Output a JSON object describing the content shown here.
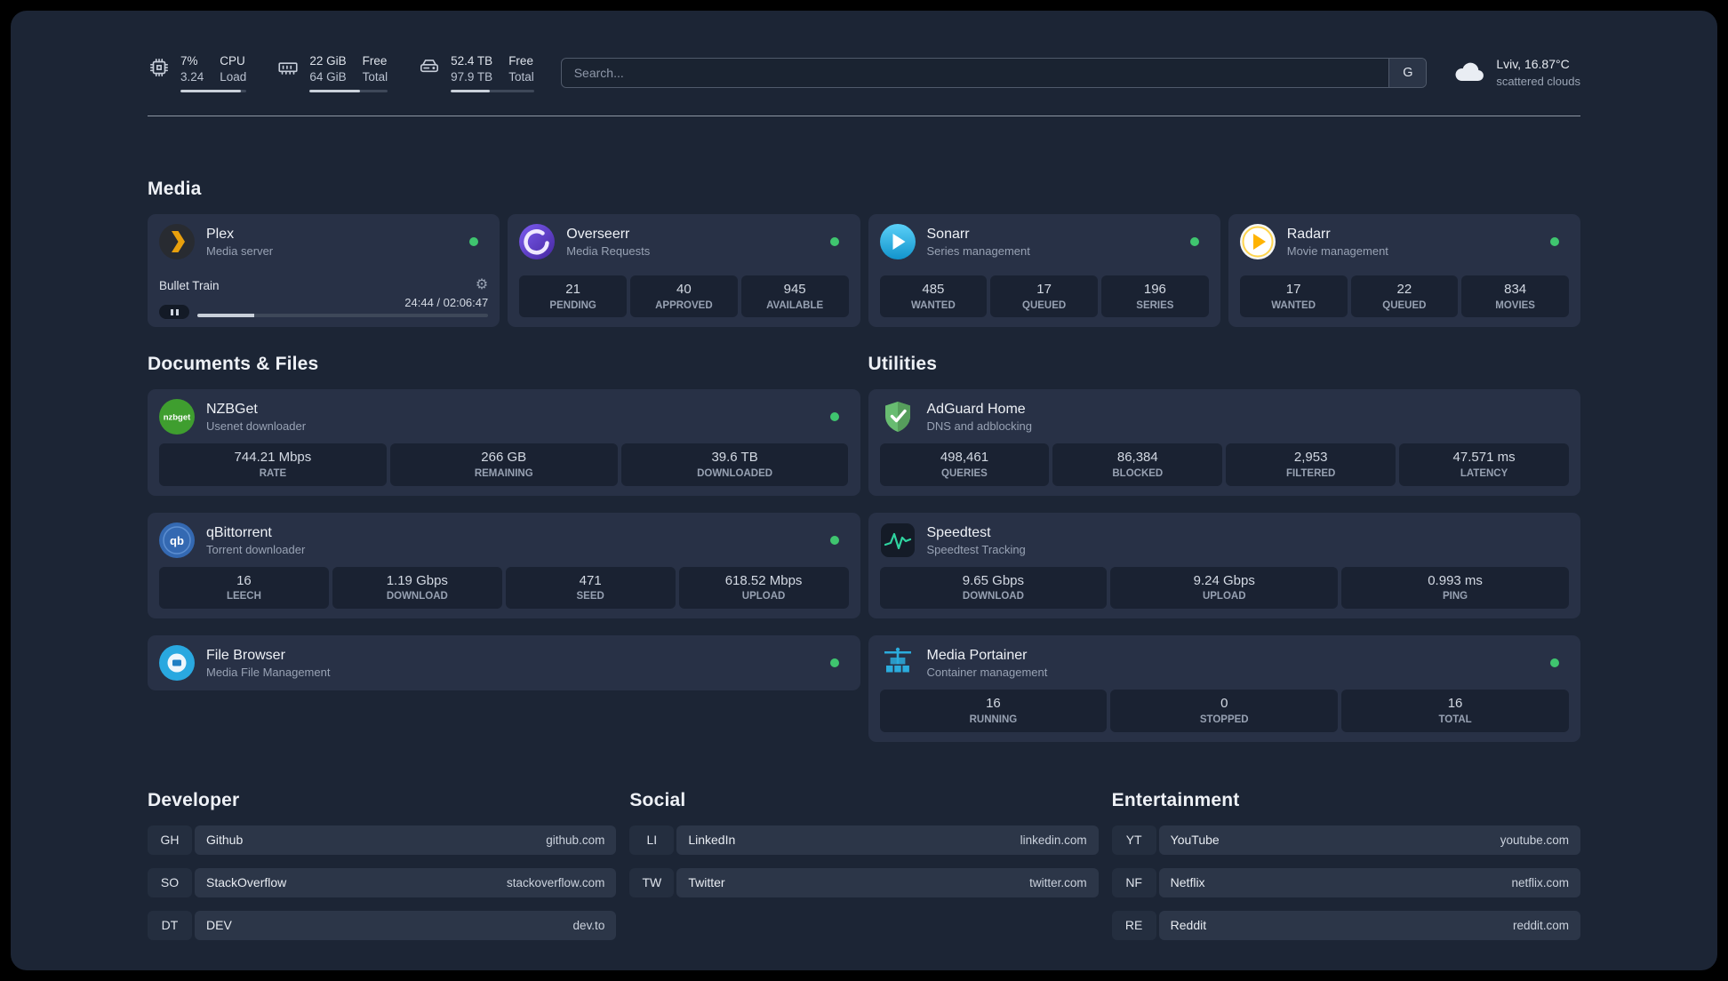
{
  "colors": {
    "background": "#1c2535",
    "status_green": "#3fc56f",
    "plex_gold": "#e8a00d",
    "portainer_blue": "#2bacdd",
    "adguard_green": "#63b663"
  },
  "topbar": {
    "resources": [
      {
        "value_top": "7%",
        "value_bottom": "3.24",
        "label_top": "CPU",
        "label_bottom": "Load",
        "progress_pct": 92
      },
      {
        "value_top": "22 GiB",
        "value_bottom": "64 GiB",
        "label_top": "Free",
        "label_bottom": "Total",
        "progress_pct": 65
      },
      {
        "value_top": "52.4 TB",
        "value_bottom": "97.9 TB",
        "label_top": "Free",
        "label_bottom": "Total",
        "progress_pct": 47
      }
    ],
    "search": {
      "placeholder": "Search...",
      "provider_label": "G"
    },
    "weather": {
      "location": "Lviv, 16.87°C",
      "condition": "scattered clouds"
    }
  },
  "media": {
    "heading": "Media",
    "plex": {
      "name": "Plex",
      "description": "Media server",
      "now_playing": {
        "title": "Bullet Train",
        "time": "24:44 / 02:06:47",
        "progress_pct": 19.6
      }
    },
    "overseerr": {
      "name": "Overseerr",
      "description": "Media Requests",
      "stats": [
        {
          "value": "21",
          "label": "PENDING"
        },
        {
          "value": "40",
          "label": "APPROVED"
        },
        {
          "value": "945",
          "label": "AVAILABLE"
        }
      ]
    },
    "sonarr": {
      "name": "Sonarr",
      "description": "Series management",
      "stats": [
        {
          "value": "485",
          "label": "WANTED"
        },
        {
          "value": "17",
          "label": "QUEUED"
        },
        {
          "value": "196",
          "label": "SERIES"
        }
      ]
    },
    "radarr": {
      "name": "Radarr",
      "description": "Movie management",
      "stats": [
        {
          "value": "17",
          "label": "WANTED"
        },
        {
          "value": "22",
          "label": "QUEUED"
        },
        {
          "value": "834",
          "label": "MOVIES"
        }
      ]
    }
  },
  "documents": {
    "heading": "Documents & Files",
    "nzbget": {
      "name": "NZBGet",
      "description": "Usenet downloader",
      "stats": [
        {
          "value": "744.21 Mbps",
          "label": "RATE"
        },
        {
          "value": "266 GB",
          "label": "REMAINING"
        },
        {
          "value": "39.6 TB",
          "label": "DOWNLOADED"
        }
      ]
    },
    "qbittorrent": {
      "name": "qBittorrent",
      "description": "Torrent downloader",
      "stats": [
        {
          "value": "16",
          "label": "LEECH"
        },
        {
          "value": "1.19 Gbps",
          "label": "DOWNLOAD"
        },
        {
          "value": "471",
          "label": "SEED"
        },
        {
          "value": "618.52 Mbps",
          "label": "UPLOAD"
        }
      ]
    },
    "filebrowser": {
      "name": "File Browser",
      "description": "Media File Management"
    }
  },
  "utilities": {
    "heading": "Utilities",
    "adguard": {
      "name": "AdGuard Home",
      "description": "DNS and adblocking",
      "stats": [
        {
          "value": "498,461",
          "label": "QUERIES"
        },
        {
          "value": "86,384",
          "label": "BLOCKED"
        },
        {
          "value": "2,953",
          "label": "FILTERED"
        },
        {
          "value": "47.571 ms",
          "label": "LATENCY"
        }
      ]
    },
    "speedtest": {
      "name": "Speedtest",
      "description": "Speedtest Tracking",
      "stats": [
        {
          "value": "9.65 Gbps",
          "label": "DOWNLOAD"
        },
        {
          "value": "9.24 Gbps",
          "label": "UPLOAD"
        },
        {
          "value": "0.993 ms",
          "label": "PING"
        }
      ]
    },
    "portainer": {
      "name": "Media Portainer",
      "description": "Container management",
      "stats": [
        {
          "value": "16",
          "label": "RUNNING"
        },
        {
          "value": "0",
          "label": "STOPPED"
        },
        {
          "value": "16",
          "label": "TOTAL"
        }
      ]
    }
  },
  "bookmarks": {
    "developer": {
      "heading": "Developer",
      "items": [
        {
          "abbr": "GH",
          "name": "Github",
          "domain": "github.com"
        },
        {
          "abbr": "SO",
          "name": "StackOverflow",
          "domain": "stackoverflow.com"
        },
        {
          "abbr": "DT",
          "name": "DEV",
          "domain": "dev.to"
        }
      ]
    },
    "social": {
      "heading": "Social",
      "items": [
        {
          "abbr": "LI",
          "name": "LinkedIn",
          "domain": "linkedin.com"
        },
        {
          "abbr": "TW",
          "name": "Twitter",
          "domain": "twitter.com"
        }
      ]
    },
    "entertainment": {
      "heading": "Entertainment",
      "items": [
        {
          "abbr": "YT",
          "name": "YouTube",
          "domain": "youtube.com"
        },
        {
          "abbr": "NF",
          "name": "Netflix",
          "domain": "netflix.com"
        },
        {
          "abbr": "RE",
          "name": "Reddit",
          "domain": "reddit.com"
        }
      ]
    }
  }
}
